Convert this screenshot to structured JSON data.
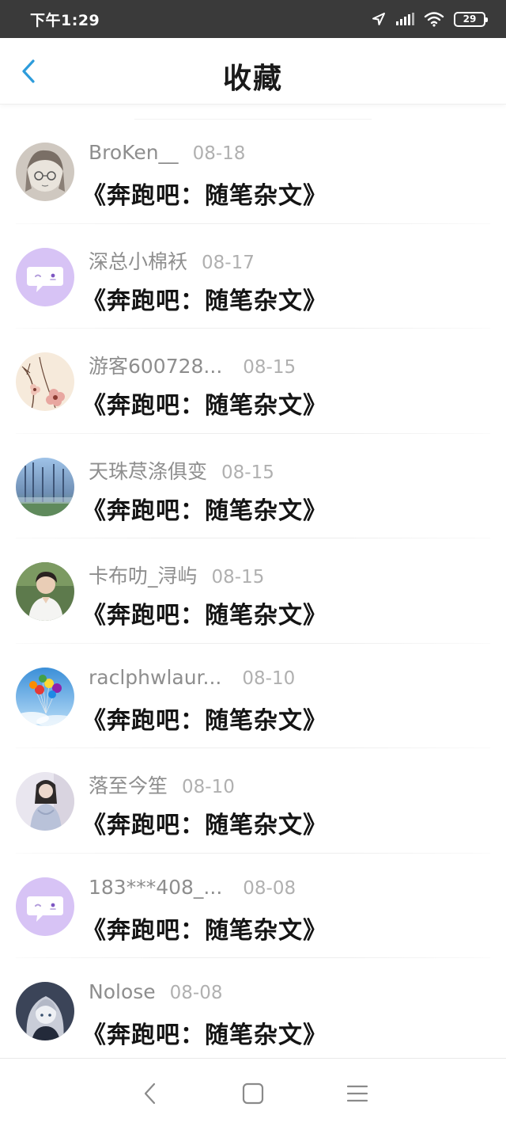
{
  "status_bar": {
    "time": "下午1:29",
    "battery": "29"
  },
  "header": {
    "title": "收藏"
  },
  "favorites": [
    {
      "user": "BroKen__",
      "date": "08-18",
      "title": "《奔跑吧：随笔杂文》",
      "avatar": "sketch-girl-avatar"
    },
    {
      "user": "深总小棉袄",
      "date": "08-17",
      "title": "《奔跑吧：随笔杂文》",
      "avatar": "chat-bubble-avatar"
    },
    {
      "user": "游客600728...",
      "date": "08-15",
      "title": "《奔跑吧：随笔杂文》",
      "avatar": "flower-avatar"
    },
    {
      "user": "天珠荩涤俱变",
      "date": "08-15",
      "title": "《奔跑吧：随笔杂文》",
      "avatar": "forest-avatar"
    },
    {
      "user": "卡布叻_浔屿",
      "date": "08-15",
      "title": "《奔跑吧：随笔杂文》",
      "avatar": "person-avatar"
    },
    {
      "user": "raclphwlaur...",
      "date": "08-10",
      "title": "《奔跑吧：随笔杂文》",
      "avatar": "balloons-avatar"
    },
    {
      "user": "落至今笙",
      "date": "08-10",
      "title": "《奔跑吧：随笔杂文》",
      "avatar": "girl-photo-avatar"
    },
    {
      "user": "183***408_...",
      "date": "08-08",
      "title": "《奔跑吧：随笔杂文》",
      "avatar": "chat-bubble-avatar"
    },
    {
      "user": "Nolose",
      "date": "08-08",
      "title": "《奔跑吧：随笔杂文》",
      "avatar": "anime-avatar"
    }
  ],
  "colors": {
    "accent": "#2d9cdb",
    "username": "#8e8e8e",
    "date": "#b0b0b0",
    "default_avatar_bg": "#d7c3f5"
  }
}
